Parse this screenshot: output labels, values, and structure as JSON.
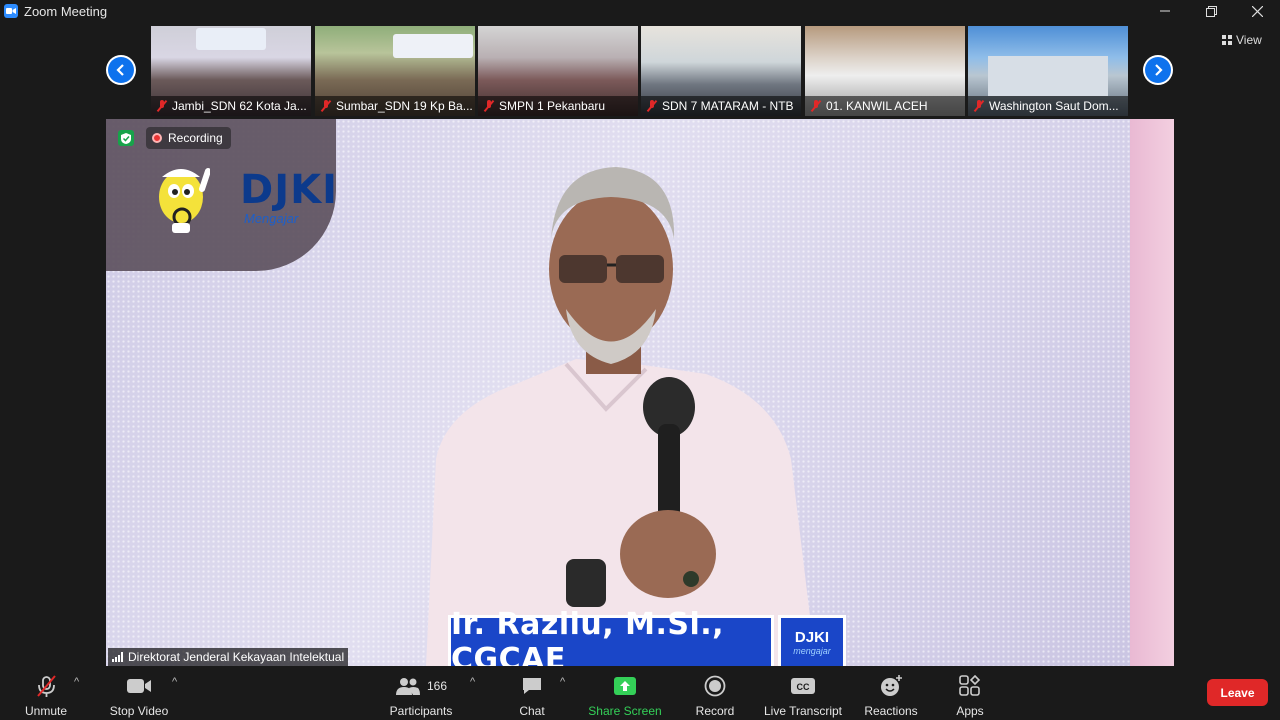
{
  "window": {
    "title": "Zoom Meeting"
  },
  "strip": {
    "view_label": "View",
    "thumbnails": [
      {
        "label": "Jambi_SDN 62 Kota Ja..."
      },
      {
        "label": "Sumbar_SDN 19 Kp Ba..."
      },
      {
        "label": "SMPN 1 Pekanbaru"
      },
      {
        "label": "SDN 7 MATARAM - NTB"
      },
      {
        "label": "01. KANWIL ACEH"
      },
      {
        "label": "Washington Saut Dom..."
      }
    ]
  },
  "main": {
    "recording_label": "Recording",
    "logo_text": "DJKI",
    "logo_sub": "Mengajar",
    "speaker_caption": "Ir. Razilu, M.Si., CGCAE",
    "caption_logo": "DJKI",
    "caption_logo_sub": "mengajar",
    "participant_name": "Direktorat Jenderal Kekayaan Intelektual"
  },
  "toolbar": {
    "unmute": "Unmute",
    "stop_video": "Stop Video",
    "participants": "Participants",
    "participants_count": "166",
    "chat": "Chat",
    "share_screen": "Share Screen",
    "record": "Record",
    "live_transcript": "Live Transcript",
    "reactions": "Reactions",
    "apps": "Apps",
    "leave": "Leave"
  },
  "colors": {
    "accent": "#0e72ed",
    "share_green": "#34d058",
    "leave_red": "#e02828",
    "caption_blue": "#1a46c8"
  }
}
